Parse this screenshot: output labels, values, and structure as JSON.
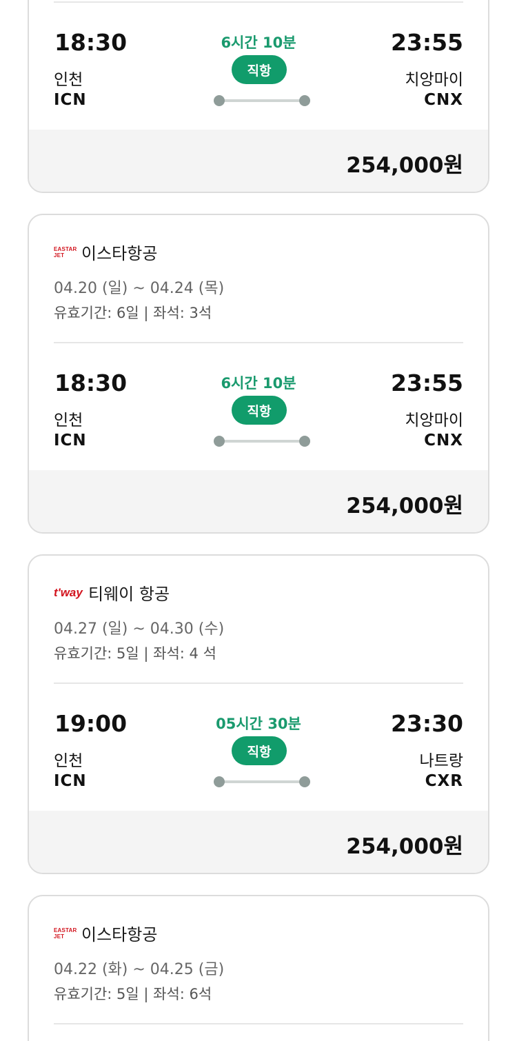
{
  "cards": [
    {
      "flight": {
        "dep_time": "18:30",
        "dep_city": "인천",
        "dep_code": "ICN",
        "duration": "6시간 10분",
        "type": "직항",
        "arr_time": "23:55",
        "arr_city": "치앙마이",
        "arr_code": "CNX"
      },
      "price": "254,000원"
    },
    {
      "airline": {
        "logo": "EASTAR JET",
        "name": "이스타항공"
      },
      "dates": "04.20 (일) ~ 04.24 (목)",
      "meta": "유효기간: 6일 | 좌석: 3석",
      "flight": {
        "dep_time": "18:30",
        "dep_city": "인천",
        "dep_code": "ICN",
        "duration": "6시간 10분",
        "type": "직항",
        "arr_time": "23:55",
        "arr_city": "치앙마이",
        "arr_code": "CNX"
      },
      "price": "254,000원"
    },
    {
      "airline": {
        "logo": "t'way",
        "name": "티웨이 항공"
      },
      "dates": "04.27 (일) ~ 04.30 (수)",
      "meta": "유효기간: 5일 | 좌석: 4 석",
      "flight": {
        "dep_time": "19:00",
        "dep_city": "인천",
        "dep_code": "ICN",
        "duration": "05시간 30분",
        "type": "직항",
        "arr_time": "23:30",
        "arr_city": "나트랑",
        "arr_code": "CXR"
      },
      "price": "254,000원"
    },
    {
      "airline": {
        "logo": "EASTAR JET",
        "name": "이스타항공"
      },
      "dates": "04.22 (화) ~ 04.25 (금)",
      "meta": "유효기간: 5일 | 좌석: 6석"
    }
  ],
  "colors": {
    "accent": "#119c6b",
    "duration_text": "#1a9a6e",
    "logo_red": "#d2141e",
    "price_bg": "#f4f4f4"
  }
}
